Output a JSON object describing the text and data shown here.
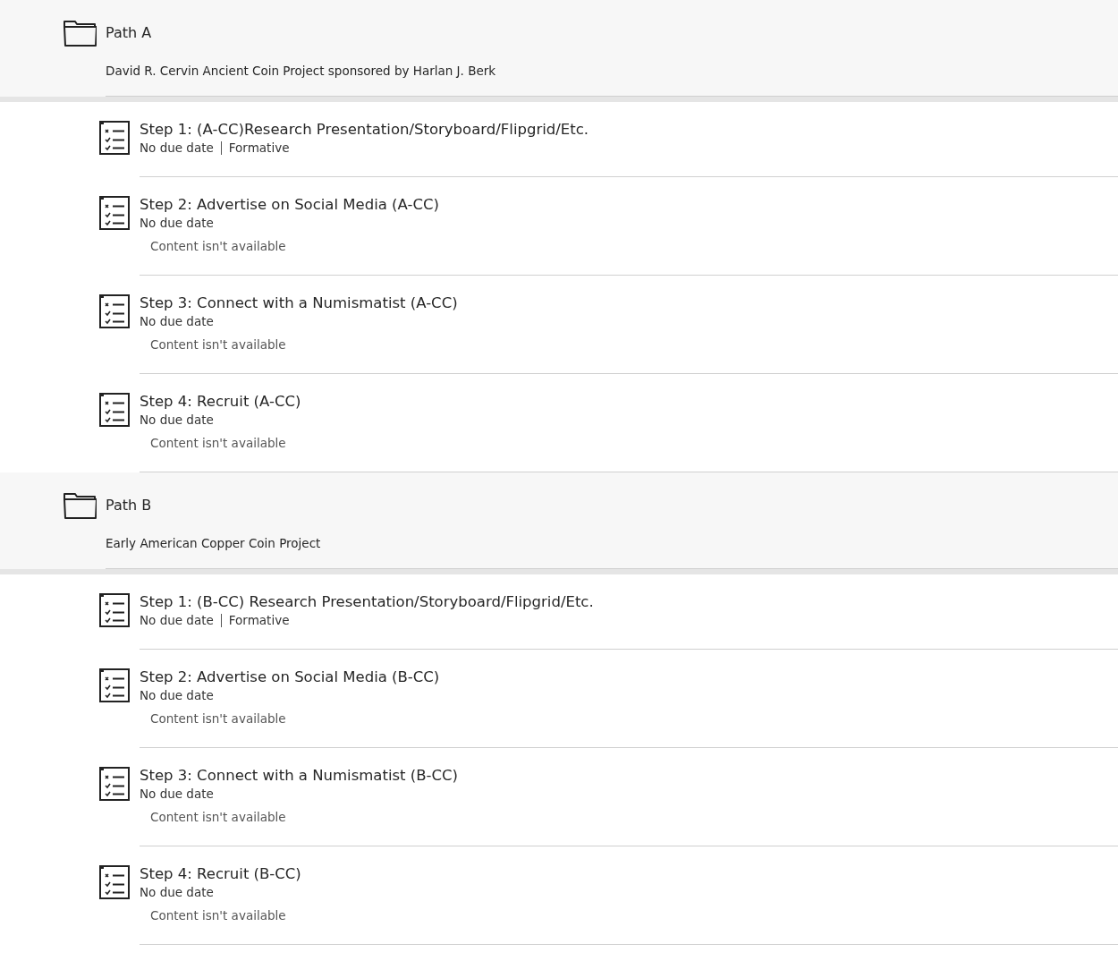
{
  "folders": [
    {
      "title": "Path A",
      "description": "David R. Cervin Ancient Coin Project sponsored by Harlan J. Berk",
      "items": [
        {
          "title": "Step 1: (A-CC)Research Presentation/Storyboard/Flipgrid/Etc.",
          "due": "No due date",
          "category": "Formative"
        },
        {
          "title": "Step 2: Advertise on Social Media (A-CC)",
          "due": "No due date",
          "note": "Content isn't available"
        },
        {
          "title": "Step 3: Connect with a Numismatist (A-CC)",
          "due": "No due date",
          "note": "Content isn't available"
        },
        {
          "title": "Step 4: Recruit (A-CC)",
          "due": "No due date",
          "note": "Content isn't available"
        }
      ]
    },
    {
      "title": "Path B",
      "description": "Early American Copper Coin Project",
      "items": [
        {
          "title": "Step 1: (B-CC) Research Presentation/Storyboard/Flipgrid/Etc.",
          "due": "No due date",
          "category": "Formative"
        },
        {
          "title": "Step 2: Advertise on Social Media (B-CC)",
          "due": "No due date",
          "note": "Content isn't available"
        },
        {
          "title": "Step 3: Connect with a Numismatist (B-CC)",
          "due": "No due date",
          "note": "Content isn't available"
        },
        {
          "title": "Step 4: Recruit (B-CC)",
          "due": "No due date",
          "note": "Content isn't available"
        }
      ]
    }
  ]
}
